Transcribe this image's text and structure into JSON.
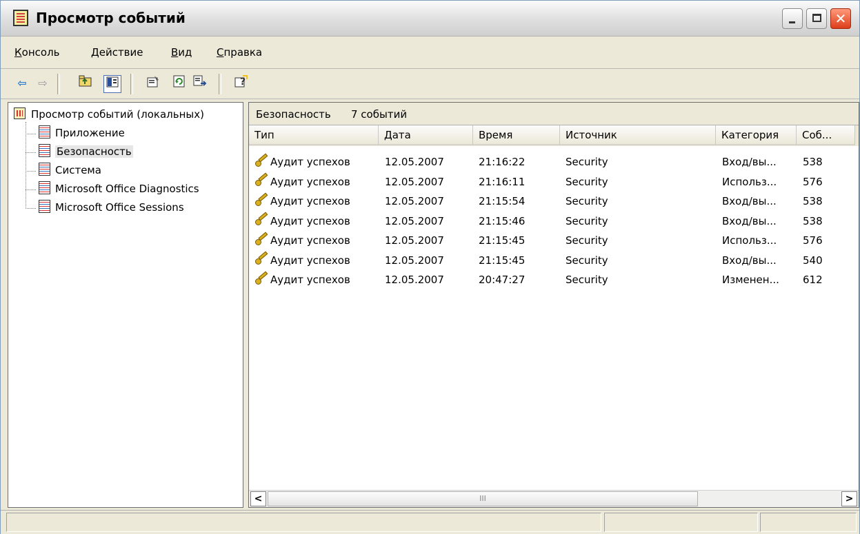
{
  "window": {
    "title": "Просмотр событий"
  },
  "menu": {
    "items": [
      {
        "accel": "К",
        "rest": "онсоль"
      },
      {
        "accel": "Д",
        "rest": "ействие"
      },
      {
        "accel": "В",
        "rest": "ид"
      },
      {
        "accel": "С",
        "rest": "правка"
      }
    ]
  },
  "toolbar": {
    "icons": [
      "back-arrow-icon",
      "forward-arrow-icon",
      "up-folder-icon",
      "show-hide-tree-icon",
      "properties-icon",
      "refresh-icon",
      "export-list-icon",
      "help-icon"
    ]
  },
  "tree": {
    "root": "Просмотр событий (локальных)",
    "items": [
      {
        "label": "Приложение"
      },
      {
        "label": "Безопасность",
        "selected": true
      },
      {
        "label": "Система"
      },
      {
        "label": "Microsoft Office Diagnostics"
      },
      {
        "label": "Microsoft Office Sessions"
      }
    ]
  },
  "list": {
    "header_title": "Безопасность",
    "header_count": "7 событий",
    "columns": [
      "Тип",
      "Дата",
      "Время",
      "Источник",
      "Категория",
      "Соб..."
    ],
    "rows": [
      {
        "type": "Аудит успехов",
        "date": "12.05.2007",
        "time": "21:16:22",
        "source": "Security",
        "category": "Вход/вы...",
        "event": "538"
      },
      {
        "type": "Аудит успехов",
        "date": "12.05.2007",
        "time": "21:16:11",
        "source": "Security",
        "category": "Использ...",
        "event": "576"
      },
      {
        "type": "Аудит успехов",
        "date": "12.05.2007",
        "time": "21:15:54",
        "source": "Security",
        "category": "Вход/вы...",
        "event": "538"
      },
      {
        "type": "Аудит успехов",
        "date": "12.05.2007",
        "time": "21:15:46",
        "source": "Security",
        "category": "Вход/вы...",
        "event": "538"
      },
      {
        "type": "Аудит успехов",
        "date": "12.05.2007",
        "time": "21:15:45",
        "source": "Security",
        "category": "Использ...",
        "event": "576"
      },
      {
        "type": "Аудит успехов",
        "date": "12.05.2007",
        "time": "21:15:45",
        "source": "Security",
        "category": "Вход/вы...",
        "event": "540"
      },
      {
        "type": "Аудит успехов",
        "date": "12.05.2007",
        "time": "20:47:27",
        "source": "Security",
        "category": "Изменен...",
        "event": "612"
      }
    ],
    "row_icon": "audit-success-key-icon"
  },
  "scrollbar": {
    "left": "<",
    "right": ">",
    "grip": "III"
  },
  "colors": {
    "window_bg": "#ece9d8",
    "close_button": "#dd3d1a",
    "selection": "#e6e6e6"
  }
}
